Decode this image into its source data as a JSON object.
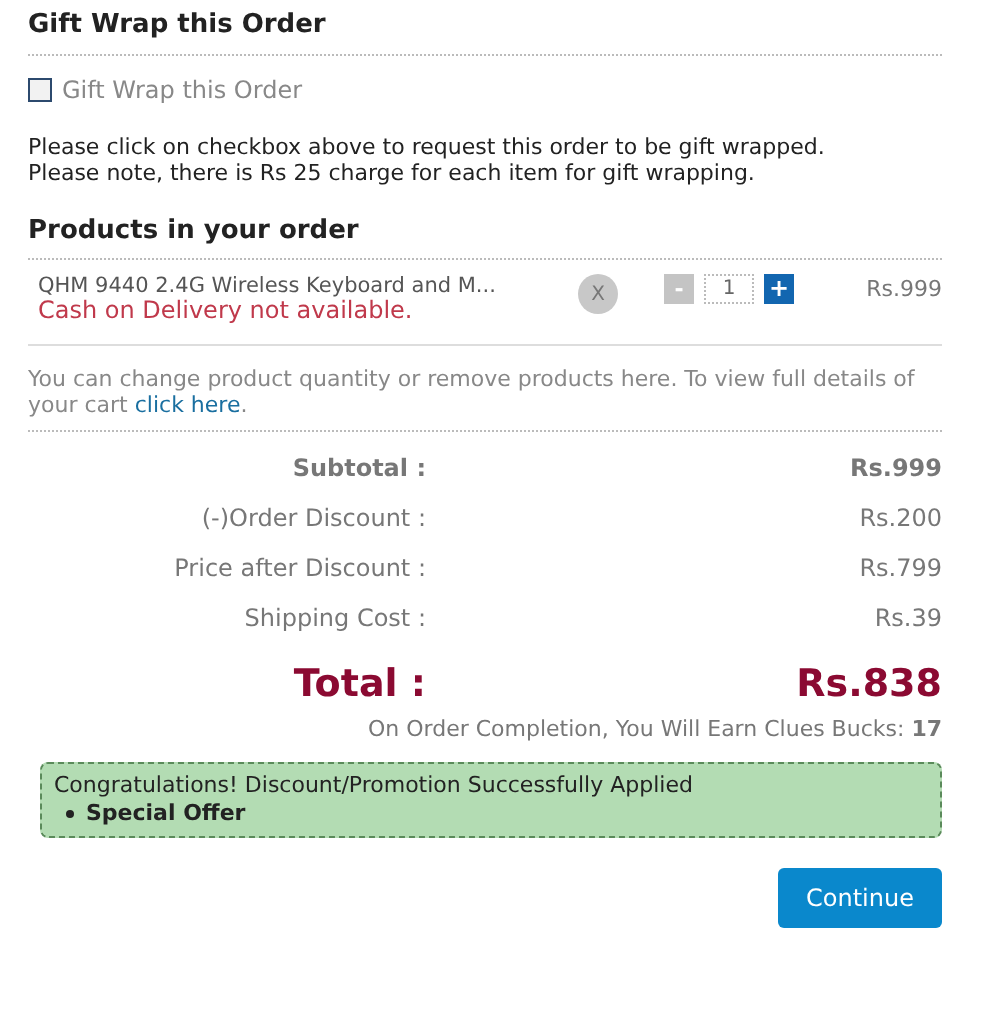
{
  "gift_wrap": {
    "heading": "Gift Wrap this Order",
    "checkbox": {
      "label": "Gift Wrap this Order",
      "checked": false
    },
    "note": "Please click on checkbox above to request this order to be gift wrapped. Please note, there is Rs 25 charge for each item for gift wrapping."
  },
  "products": {
    "heading": "Products in your order",
    "items": [
      {
        "name": "QHM 9440 2.4G Wireless Keyboard and M...",
        "warning": "Cash on Delivery not available.",
        "remove": "X",
        "minus": "-",
        "quantity": "1",
        "plus": "+",
        "price": "Rs.999"
      }
    ]
  },
  "cart_note": {
    "text": "You can change product quantity or remove products here. To view full details of your cart",
    "link": "click here",
    "end": "."
  },
  "summary": [
    {
      "kind": "subtotal",
      "label": "Subtotal :",
      "value": "Rs.999"
    },
    {
      "kind": "row",
      "label": "(-)Order Discount :",
      "value": "Rs.200"
    },
    {
      "kind": "row",
      "label": "Price after Discount :",
      "value": "Rs.799"
    },
    {
      "kind": "row",
      "label": "Shipping Cost :",
      "value": "Rs.39"
    },
    {
      "kind": "total",
      "label": "Total :",
      "value": "Rs.838"
    }
  ],
  "clues_bucks": "On Order Completion, You Will Earn Clues Bucks: **17**",
  "promotion": {
    "message": "Congratulations! Discount/Promotion Successfully Applied",
    "offers": [
      "Special Offer"
    ]
  },
  "continue_button": "Continue"
}
